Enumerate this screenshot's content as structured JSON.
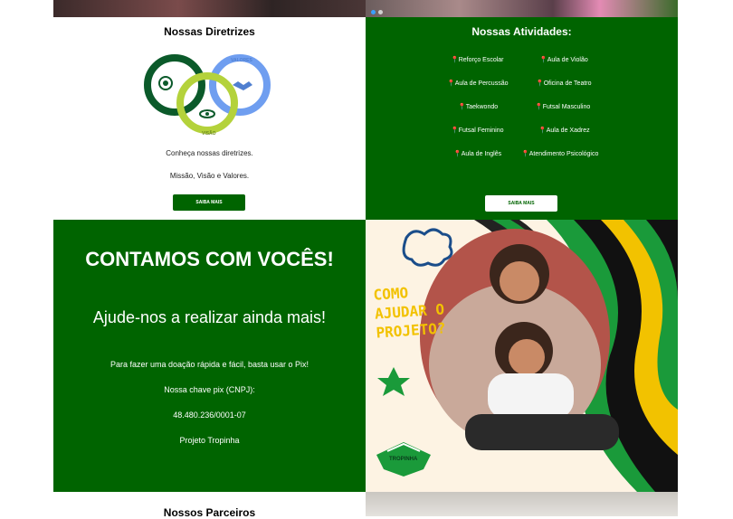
{
  "diretrizes": {
    "title": "Nossas Diretrizes",
    "logo": {
      "missao": "MISSÃO",
      "valores": "VALORES",
      "visao": "VISÃO"
    },
    "line1": "Conheça nossas diretrizes.",
    "line2": "Missão, Visão e Valores.",
    "button": "SAIBA MAIS"
  },
  "atividades": {
    "title": "Nossas Atividades:",
    "left": [
      "Reforço Escolar",
      "Aula de Percussão",
      "Taekwondo",
      "Futsal Feminino",
      "Aula de Inglês"
    ],
    "right": [
      "Aula de Violão",
      "Oficina de Teatro",
      "Futsal Masculino",
      "Aula de Xadrez",
      "Atendimento Psicológico"
    ],
    "button": "SAIBA MAIS"
  },
  "contamos": {
    "heading": "CONTAMOS COM VOCÊS!",
    "subheading": "Ajude-nos a realizar ainda mais!",
    "line1": "Para fazer uma doação rápida e fácil, basta usar o Pix!",
    "line2": "Nossa chave pix (CNPJ):",
    "cnpj": "48.480.236/0001-07",
    "name": "Projeto Tropinha"
  },
  "promo": {
    "line1": "COMO",
    "line2": "AJUDAR O",
    "line3": "PROJETO?",
    "badge": "TROPINHA"
  },
  "parceiros": {
    "title": "Nossos Parceiros"
  },
  "colors": {
    "green": "#006400",
    "yellow": "#f2c200",
    "accent_green": "#1a9a3a"
  }
}
